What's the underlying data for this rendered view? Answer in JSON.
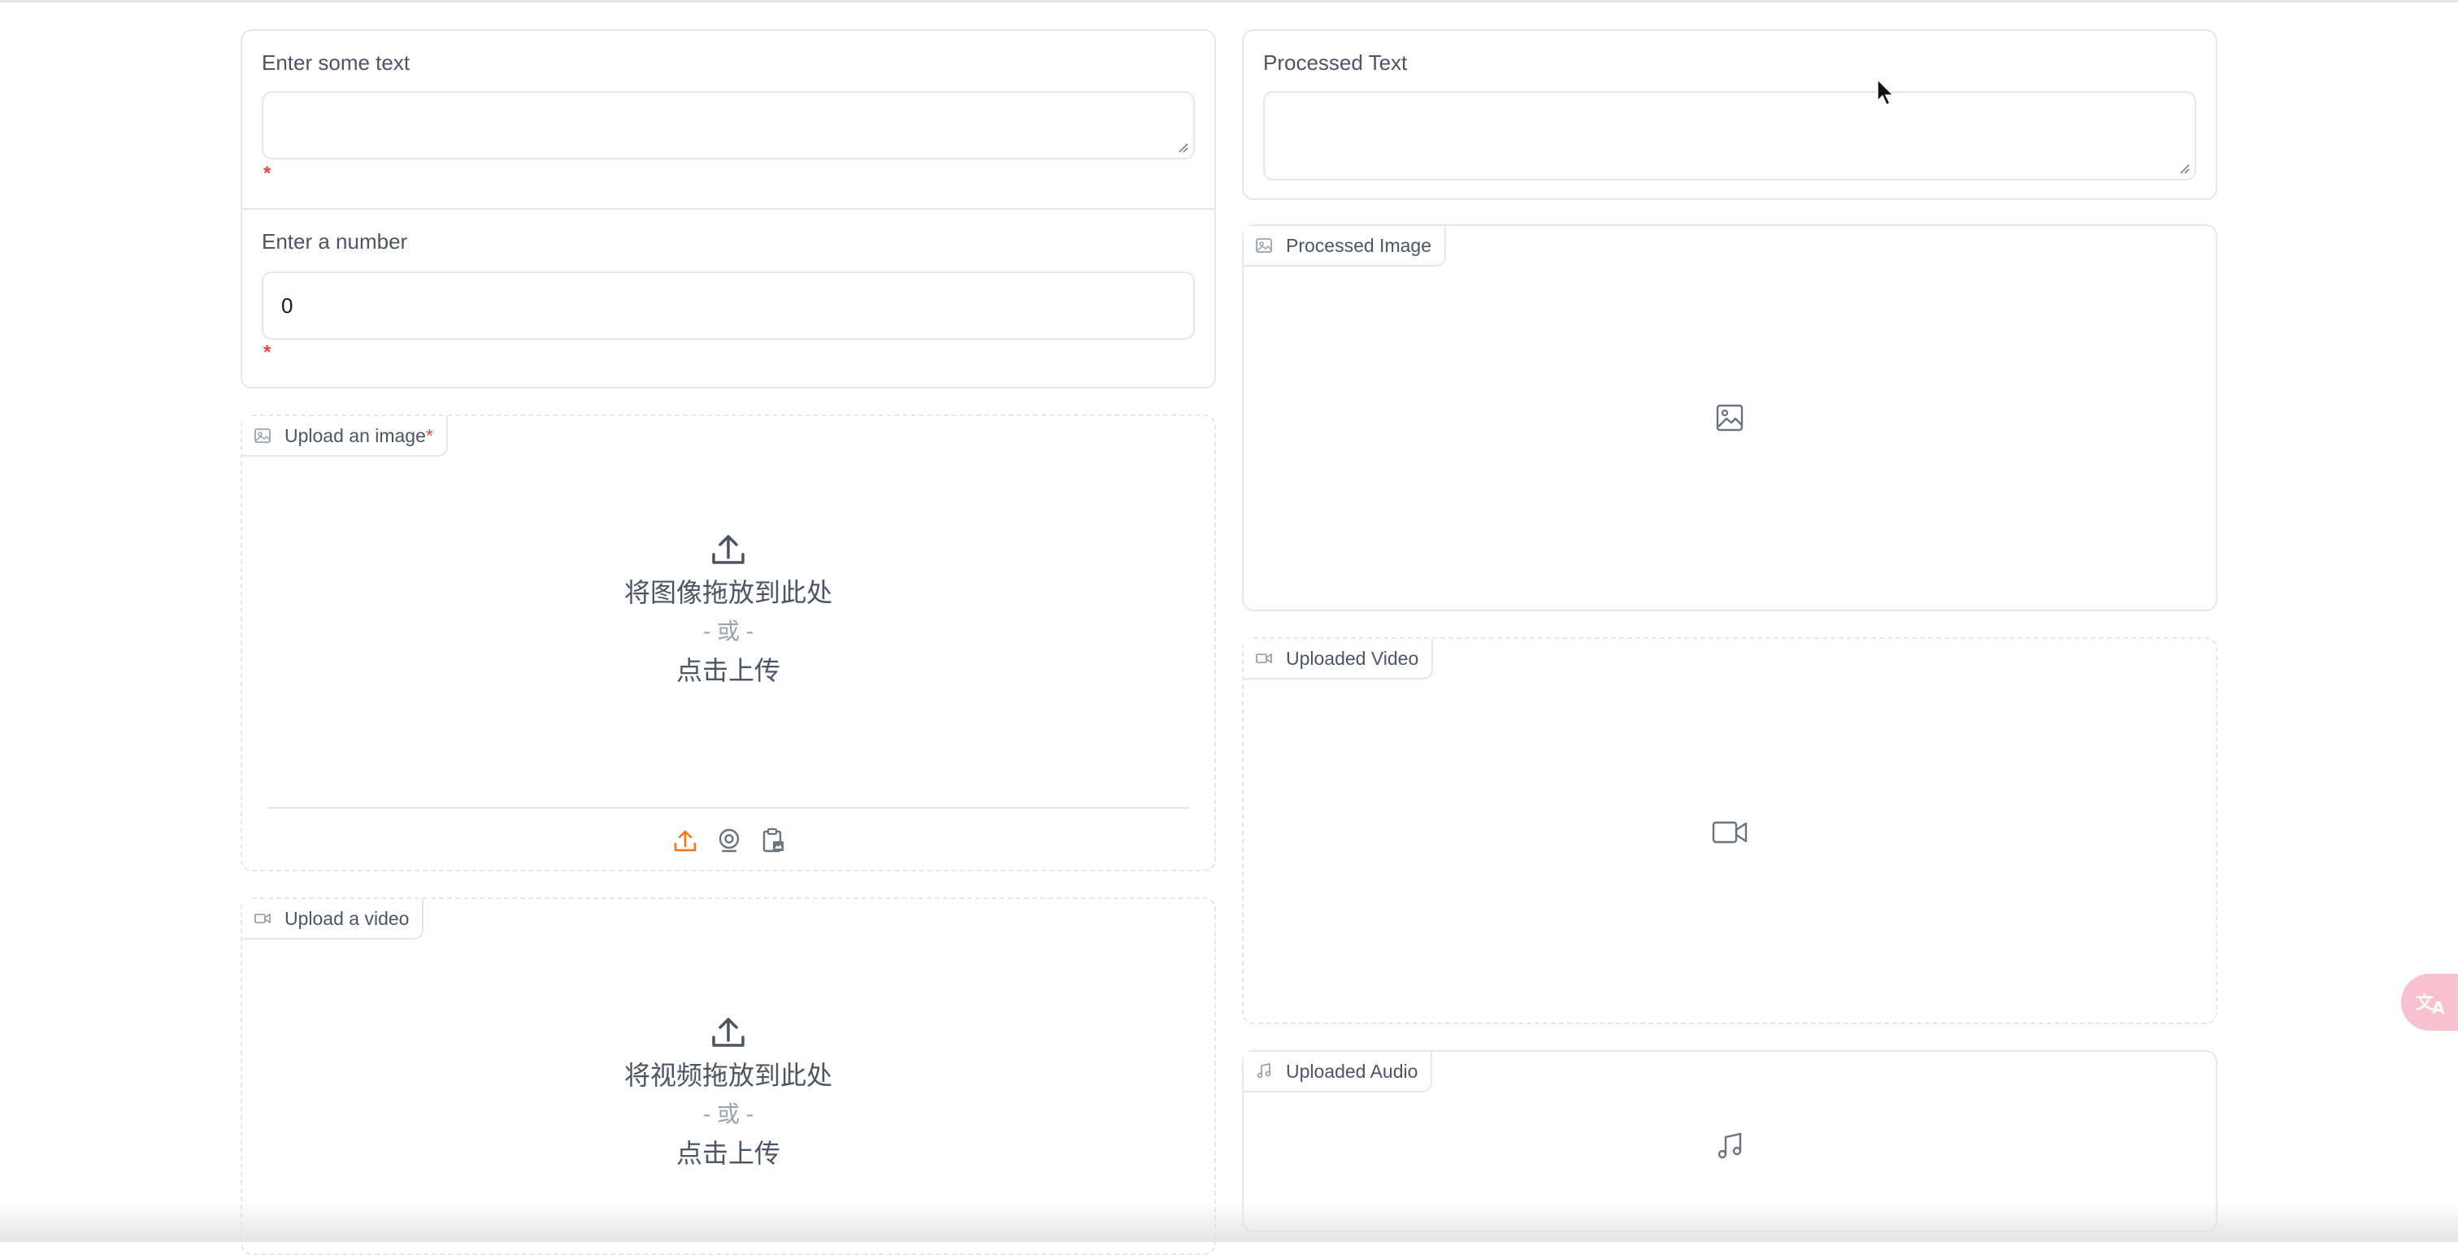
{
  "left": {
    "text_input": {
      "label": "Enter some text",
      "value": "",
      "required_mark": "*"
    },
    "number_input": {
      "label": "Enter a number",
      "value": "0",
      "required_mark": "*"
    },
    "image_upload": {
      "label": "Upload an image",
      "required_mark": "*",
      "drop_text": "将图像拖放到此处",
      "or_text": "- 或 -",
      "click_text": "点击上传",
      "sources": [
        "upload-icon",
        "webcam-icon",
        "clipboard-icon"
      ],
      "active_source_color": "#f97316"
    },
    "video_upload": {
      "label": "Upload a video",
      "drop_text": "将视频拖放到此处",
      "or_text": "- 或 -",
      "click_text": "点击上传"
    }
  },
  "right": {
    "processed_text": {
      "label": "Processed Text",
      "value": ""
    },
    "processed_image": {
      "label": "Processed Image",
      "icon": "image-icon"
    },
    "uploaded_video": {
      "label": "Uploaded Video",
      "icon": "video-icon"
    },
    "uploaded_audio": {
      "label": "Uploaded Audio",
      "icon": "music-icon"
    }
  },
  "floating": {
    "translate_icon": "translate-icon"
  }
}
